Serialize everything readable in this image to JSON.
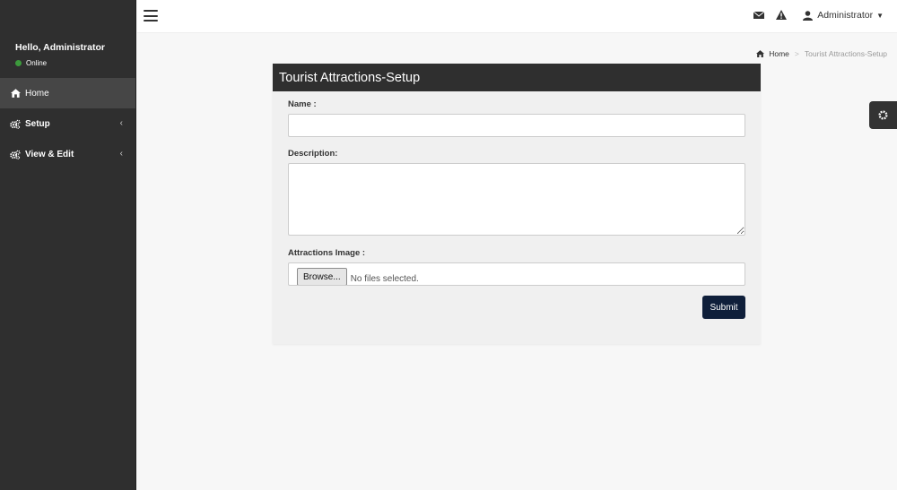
{
  "sidebar": {
    "greeting": "Hello, Administrator",
    "status": "Online",
    "items": [
      {
        "label": "Home",
        "icon": "home-icon"
      },
      {
        "label": "Setup",
        "icon": "cogs-icon"
      },
      {
        "label": "View & Edit",
        "icon": "cogs-icon"
      }
    ]
  },
  "topbar": {
    "user_label": "Administrator",
    "icons": [
      "envelope-icon",
      "warning-icon",
      "user-icon"
    ]
  },
  "breadcrumb": {
    "home": "Home",
    "current": "Tourist Attractions-Setup"
  },
  "form": {
    "title": "Tourist Attractions-Setup",
    "name_label": "Name :",
    "name_value": "",
    "description_label": "Description:",
    "description_value": "",
    "image_label": "Attractions Image :",
    "browse_label": "Browse...",
    "file_status": "No files selected.",
    "submit_label": "Submit"
  },
  "colors": {
    "sidebar_bg": "#2f2f2f",
    "header_bg": "#2f2f2f",
    "submit_bg": "#0f1f3a",
    "online": "#3c9a3c"
  }
}
